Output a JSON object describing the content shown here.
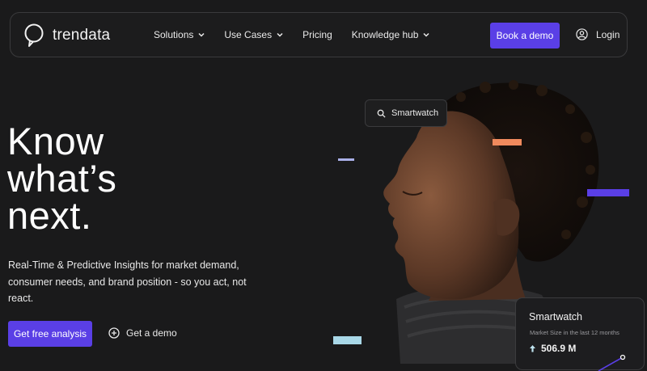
{
  "nav": {
    "brand": "trendata",
    "items": [
      {
        "label": "Solutions",
        "has_dropdown": true
      },
      {
        "label": "Use Cases",
        "has_dropdown": true
      },
      {
        "label": "Pricing",
        "has_dropdown": false
      },
      {
        "label": "Knowledge hub",
        "has_dropdown": true
      }
    ],
    "cta_label": "Book a demo",
    "login_label": "Login"
  },
  "hero": {
    "headline": [
      "Know",
      "what’s",
      "next."
    ],
    "subtext": "Real-Time & Predictive Insights for market demand, consumer needs, and brand position - so you act, not react.",
    "primary_cta": "Get free analysis",
    "secondary_cta": "Get a demo"
  },
  "visual": {
    "search_chip": "Smartwatch",
    "card": {
      "title": "Smartwatch",
      "subtitle": "Market Size in the last 12 months",
      "value": "506.9 M",
      "trend": "up"
    }
  },
  "colors": {
    "background": "#1a1a1b",
    "accent": "#5a3fe6",
    "deco_orange": "#f08a5d",
    "deco_blue": "#a9d8e8",
    "deco_lavender": "#aab0e8"
  },
  "icons": {
    "logo": "speech-bubble-logo-icon",
    "dropdown": "chevron-down-icon",
    "login": "user-circle-icon",
    "demo": "plus-circle-icon",
    "search": "search-icon",
    "trend": "arrow-up-icon"
  }
}
